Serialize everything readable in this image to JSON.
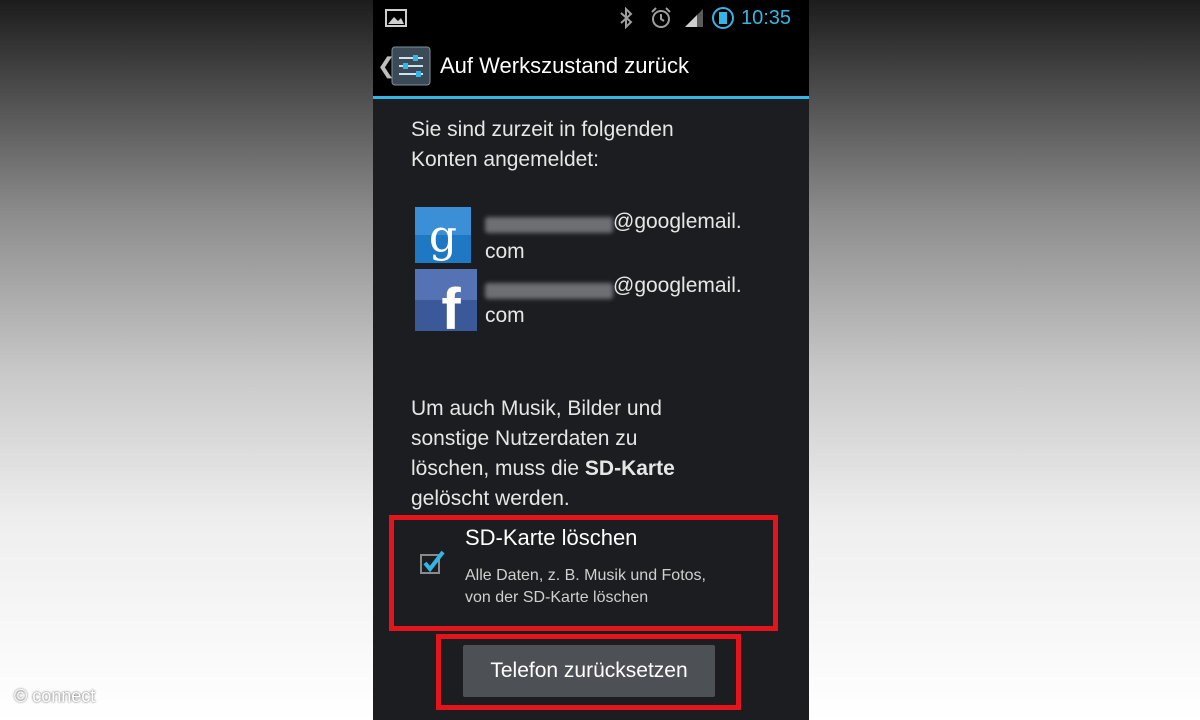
{
  "statusbar": {
    "time": "10:35",
    "icons": [
      "image-notification-icon",
      "bluetooth-icon",
      "alarm-icon",
      "signal-icon",
      "battery-icon"
    ]
  },
  "actionbar": {
    "back_glyph": "❮",
    "settings_icon": "settings-sliders-icon",
    "title": "Auf Werkszustand zurück"
  },
  "intro": {
    "line1": "Sie sind zurzeit in folgenden",
    "line2": "Konten angemeldet:"
  },
  "accounts": [
    {
      "icon": "google-icon",
      "email_suffix": "@googlemail.",
      "email_tail": "com"
    },
    {
      "icon": "facebook-icon",
      "email_suffix": "@googlemail.",
      "email_tail": "com"
    }
  ],
  "warning": {
    "line1": "Um auch Musik, Bilder und",
    "line2": "sonstige Nutzerdaten zu",
    "line3_prefix": "löschen, muss die ",
    "line3_bold": "SD-Karte",
    "line4": "gelöscht werden."
  },
  "sd_option": {
    "checked": true,
    "title": "SD-Karte löschen",
    "description_line1": "Alle Daten, z. B. Musik und Fotos,",
    "description_line2": "von der SD-Karte löschen"
  },
  "reset_button": {
    "label": "Telefon zurücksetzen"
  },
  "watermark": {
    "text": "© connect"
  },
  "colors": {
    "accent": "#33b5e5",
    "highlight": "#e3141b",
    "background": "#1b1d20",
    "button": "#4d5055"
  }
}
